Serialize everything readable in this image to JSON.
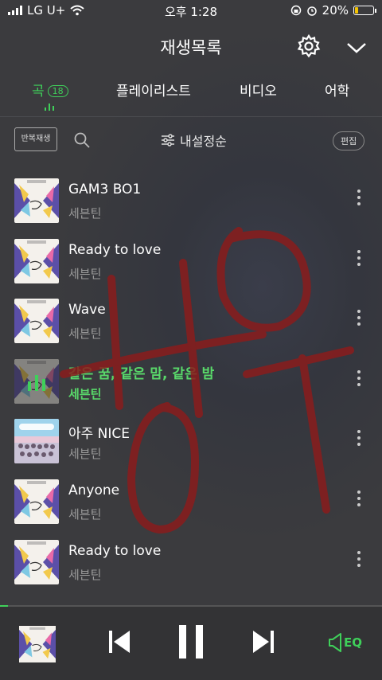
{
  "status_bar": {
    "carrier": "LG U+",
    "time": "오후 1:28",
    "battery": "20%",
    "battery_level": 0.2
  },
  "header": {
    "title": "재생목록",
    "settings_icon": "gear-icon",
    "collapse_icon": "chevron-down-icon"
  },
  "tabs": [
    {
      "label": "곡",
      "count": "18",
      "active": true
    },
    {
      "label": "플레이리스트",
      "active": false
    },
    {
      "label": "비디오",
      "active": false
    },
    {
      "label": "어학",
      "active": false
    }
  ],
  "toolbar": {
    "repeat_label": "반복재생",
    "sort_label": "내설정순",
    "edit_label": "편집"
  },
  "songs": [
    {
      "title": "GAM3 BO1",
      "artist": "세븐틴",
      "art": "your-choice",
      "playing": false
    },
    {
      "title": "Ready to love",
      "artist": "세븐틴",
      "art": "your-choice",
      "playing": false
    },
    {
      "title": "Wave",
      "artist": "세븐틴",
      "art": "your-choice",
      "playing": false
    },
    {
      "title": "같은 꿈, 같은 맘, 같은 밤",
      "artist": "세븐틴",
      "art": "your-choice",
      "playing": true
    },
    {
      "title": "아주 NICE",
      "artist": "세븐틴",
      "art": "seventeen-group",
      "playing": false
    },
    {
      "title": "Anyone",
      "artist": "세븐틴",
      "art": "your-choice",
      "playing": false
    },
    {
      "title": "Ready to love",
      "artist": "세븐틴",
      "art": "your-choice",
      "playing": false
    }
  ],
  "player": {
    "progress": 0.02,
    "eq_label": "EQ"
  },
  "colors": {
    "accent": "#3fd05a",
    "background": "#38393d",
    "scribble": "#8a1c1c"
  }
}
